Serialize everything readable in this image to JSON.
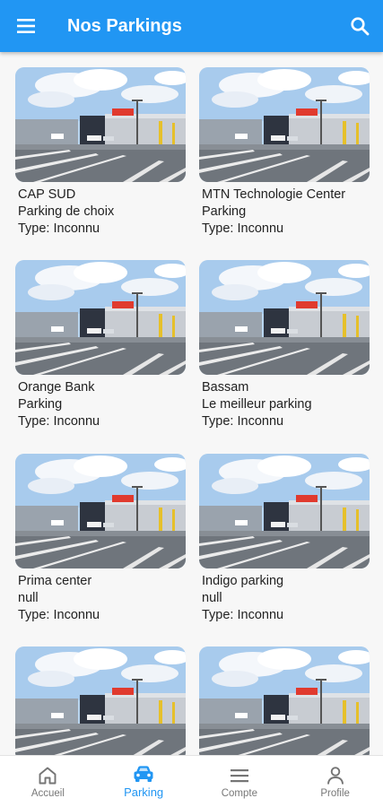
{
  "header": {
    "title": "Nos Parkings",
    "menu_icon": "hamburger-menu-icon",
    "search_icon": "search-icon"
  },
  "parkings": [
    {
      "name": "CAP SUD",
      "description": "Parking de choix",
      "type": "Type: Inconnu"
    },
    {
      "name": "MTN Technologie Center",
      "description": "Parking",
      "type": "Type: Inconnu"
    },
    {
      "name": "Orange Bank",
      "description": "Parking",
      "type": "Type: Inconnu"
    },
    {
      "name": "Bassam",
      "description": "Le meilleur parking",
      "type": "Type: Inconnu"
    },
    {
      "name": "Prima center",
      "description": "null",
      "type": "Type: Inconnu"
    },
    {
      "name": "Indigo parking",
      "description": "null",
      "type": "Type: Inconnu"
    },
    {
      "name": "",
      "description": "",
      "type": ""
    },
    {
      "name": "",
      "description": "",
      "type": ""
    }
  ],
  "bottom_nav": [
    {
      "label": "Accueil",
      "icon": "home-icon",
      "active": false
    },
    {
      "label": "Parking",
      "icon": "car-icon",
      "active": true
    },
    {
      "label": "Compte",
      "icon": "list-icon",
      "active": false
    },
    {
      "label": "Profile",
      "icon": "person-icon",
      "active": false
    }
  ],
  "colors": {
    "primary": "#2196f3",
    "inactive": "#777777",
    "background": "#f7f7f7"
  }
}
